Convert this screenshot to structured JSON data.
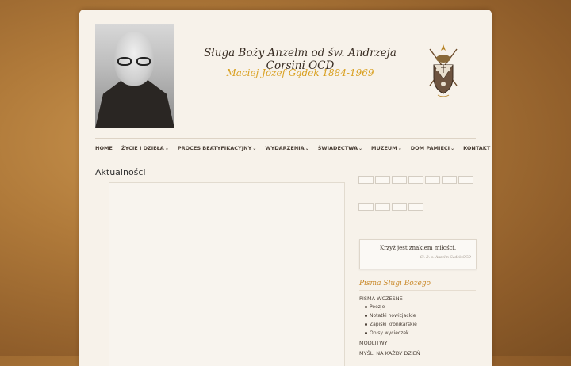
{
  "header": {
    "title": "Sługa Boży Anzelm od św. Andrzeja Corsini OCD",
    "subtitle": "Maciej Józef Gądek 1884-1969"
  },
  "nav": {
    "items": [
      {
        "label": "HOME",
        "has_dropdown": false
      },
      {
        "label": "ŻYCIE I DZIEŁA",
        "has_dropdown": true
      },
      {
        "label": "PROCES BEATYFIKACYJNY",
        "has_dropdown": true
      },
      {
        "label": "WYDARZENIA",
        "has_dropdown": true
      },
      {
        "label": "ŚWIADECTWA",
        "has_dropdown": true
      },
      {
        "label": "MUZEUM",
        "has_dropdown": true
      },
      {
        "label": "DOM PAMIĘCI",
        "has_dropdown": true
      },
      {
        "label": "KONTAKT",
        "has_dropdown": true
      }
    ],
    "chevron": "⌄"
  },
  "main": {
    "title": "Aktualności"
  },
  "sidebar": {
    "quote": {
      "text": "Krzyż jest znakiem miłości.",
      "author": "—Sł. B. o. Anzelm Gądek OCD"
    },
    "writings": {
      "heading": "Pisma Sługi Bożego",
      "category_early": "PISMA WCZESNE",
      "items": [
        "Poezje",
        "Notatki nowicjackie",
        "Zapiski kronikarskie",
        "Opisy wycieczek"
      ],
      "category_prayers": "MODLITWY",
      "category_thoughts": "MYŚLI NA KAŻDY DZIEŃ"
    }
  },
  "colors": {
    "accent_gold": "#d9a020",
    "heading_orange": "#c9892a",
    "background_brown": "#b07a3a"
  }
}
